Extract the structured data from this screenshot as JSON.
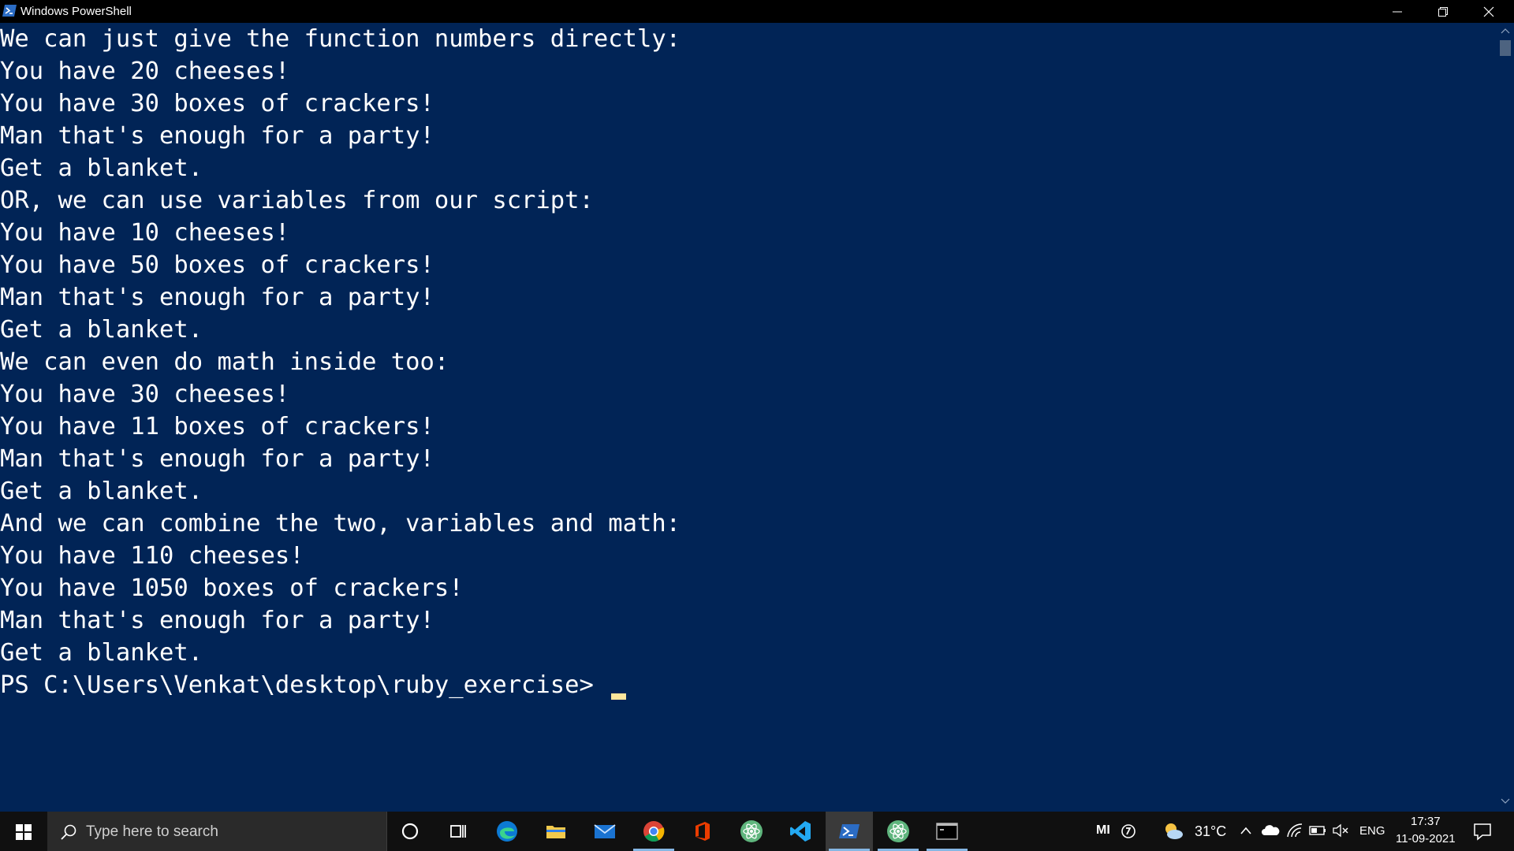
{
  "window": {
    "title": "Windows PowerShell",
    "controls": {
      "minimize": "minimize",
      "restore": "restore",
      "close": "close"
    }
  },
  "console": {
    "lines": [
      "We can just give the function numbers directly:",
      "You have 20 cheeses!",
      "You have 30 boxes of crackers!",
      "Man that's enough for a party!",
      "Get a blanket.",
      "OR, we can use variables from our script:",
      "You have 10 cheeses!",
      "You have 50 boxes of crackers!",
      "Man that's enough for a party!",
      "Get a blanket.",
      "We can even do math inside too:",
      "You have 30 cheeses!",
      "You have 11 boxes of crackers!",
      "Man that's enough for a party!",
      "Get a blanket.",
      "And we can combine the two, variables and math:",
      "You have 110 cheeses!",
      "You have 1050 boxes of crackers!",
      "Man that's enough for a party!",
      "Get a blanket."
    ],
    "prompt": "PS C:\\Users\\Venkat\\desktop\\ruby_exercise> "
  },
  "taskbar": {
    "search_placeholder": "Type here to search",
    "apps": [
      "cortana-icon",
      "task-view-icon",
      "edge-icon",
      "file-explorer-icon",
      "mail-icon",
      "chrome-icon",
      "office-icon",
      "atom-icon",
      "vscode-icon",
      "powershell-icon",
      "atom-icon",
      "terminal-icon"
    ],
    "active_app": "powershell-icon",
    "tray": {
      "mi_label": "MI",
      "temperature": "31°C",
      "language": "ENG",
      "time": "17:37",
      "date": "11-09-2021"
    }
  },
  "colors": {
    "console_bg": "#012456",
    "titlebar_bg": "#000000",
    "taskbar_bg": "#101010",
    "cursor": "#fde69c"
  }
}
